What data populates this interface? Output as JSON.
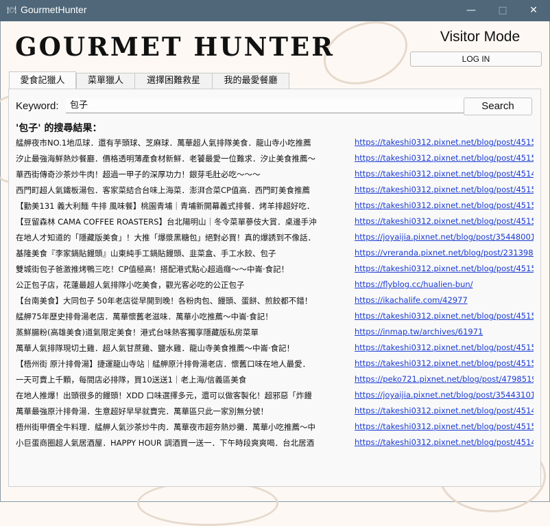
{
  "window": {
    "title": "GourmetHunter",
    "icon": "app-logo-icon"
  },
  "header": {
    "logo": "GOURMET HUNTER",
    "mode_label": "Visitor Mode",
    "login_label": "LOG IN"
  },
  "tabs": [
    {
      "label": "愛食記獵人",
      "active": true
    },
    {
      "label": "菜單獵人"
    },
    {
      "label": "選擇困難救星"
    },
    {
      "label": "我的最愛餐廳"
    }
  ],
  "search": {
    "keyword_label": "Keyword:",
    "value": "包子",
    "button_label": "Search"
  },
  "results_heading": "'包子' 的搜尋結果：",
  "results": [
    {
      "title": "艋舺夜市NO.1地瓜球．還有芋頭球、芝麻球．萬華超人氣排隊美食．龍山寺小吃推薦",
      "url": "https://takeshi0312.pixnet.net/blog/post/4515"
    },
    {
      "title": "汐止最強海鮮熱炒餐廳．價格透明薄產食材新鮮．老饕最愛一位難求．汐止美食推薦～",
      "url": "https://takeshi0312.pixnet.net/blog/post/4515"
    },
    {
      "title": "華西街傳奇沙茶炒牛肉！超過一甲子的深厚功力！銀芽毛肚必吃～～～",
      "url": "https://takeshi0312.pixnet.net/blog/post/4514"
    },
    {
      "title": "西門町超人氣鐵板湯包．客家菜結合台味上海菜．澎湃合菜CP值高．西門町美食推薦",
      "url": "https://takeshi0312.pixnet.net/blog/post/4515"
    },
    {
      "title": "【勤美131 義大利麵 牛排 風味餐】桃園青埔｜青埔新開幕義式排餐．烤羊排超好吃．",
      "url": "https://takeshi0312.pixnet.net/blog/post/4515"
    },
    {
      "title": "【豆留森林 CAMA COFFEE ROASTERS】台北陽明山｜冬令菜單蔘伎大賞．桌邊手沖",
      "url": "https://takeshi0312.pixnet.net/blog/post/4515"
    },
    {
      "title": "在地人才知道的「隱藏版美食」！大推「爆漿黑糖包」絕對必買！真的爆誘到不像話．",
      "url": "https://joyaijia.pixnet.net/blog/post/35448001"
    },
    {
      "title": "基隆美食『李家鍋貼饅頭』山東純手工鍋貼饅頭、韭菜盒、手工水餃、包子",
      "url": "https://vreranda.pixnet.net/blog/post/2313987"
    },
    {
      "title": "雙城街包子爸激推烤鴨三吃！CP值極高！搭配港式點心超過癮～～中崙·食記！",
      "url": "https://takeshi0312.pixnet.net/blog/post/4515"
    },
    {
      "title": "公正包子店，花蓮最超人氣排隊小吃美食，觀光客必吃的公正包子",
      "url": "https://flyblog.cc/hualien-bun/"
    },
    {
      "title": "【台南美食】大同包子 50年老店從早開到晚！各粉肉包、饅頭、蛋餅、煎餃都不錯！",
      "url": "https://ikachalife.com/42977"
    },
    {
      "title": "艋舺75年歷史排骨湯老店．萬華懷舊老滋味．萬華小吃推薦～中崙·食記！",
      "url": "https://takeshi0312.pixnet.net/blog/post/4515"
    },
    {
      "title": "蒸鮮腸粉(高雄美食)道氣限定美食！港式台味熱客獨享隱藏版私房菜單",
      "url": "https://inmap.tw/archives/61971"
    },
    {
      "title": "萬華人氣排隊現切土雞．超人氣甘蔗雞、鹽水雞．龍山寺美食推薦～中崙·食記！",
      "url": "https://takeshi0312.pixnet.net/blog/post/4515"
    },
    {
      "title": "【梧州街 原汁排骨湯】捷運龍山寺站｜艋舺原汁排骨湯老店．懷舊口味在地人最愛．",
      "url": "https://takeshi0312.pixnet.net/blog/post/4515"
    },
    {
      "title": "一天可賣上千顆，每間店必排隊，買10送送1｜老上海/信義區美食",
      "url": "https://peko721.pixnet.net/blog/post/4798519"
    },
    {
      "title": "在地人推爆！出頭很多的饅頭！XDD 口味選擇多元，還可以做客製化！超邪惡「炸饅",
      "url": "https://joyaijia.pixnet.net/blog/post/35443101"
    },
    {
      "title": "萬華最強原汁排骨湯．生意超好早早就賣完．萬華區只此一家別無分號！",
      "url": "https://takeshi0312.pixnet.net/blog/post/4514"
    },
    {
      "title": "梧州街甲價全牛料理．艋舺人氣沙茶炒牛肉．萬華夜市超夯熱炒攤．萬華小吃推薦～中",
      "url": "https://takeshi0312.pixnet.net/blog/post/4515"
    },
    {
      "title": "小巨蛋商圈超人氣居酒屋．HAPPY HOUR 調酒買一送一．下午時段爽爽喝．台北居酒",
      "url": "https://takeshi0312.pixnet.net/blog/post/4514"
    }
  ],
  "colors": {
    "titlebar": "#4f6779",
    "link": "#1a3bd4",
    "background": "#fdf8f3"
  }
}
